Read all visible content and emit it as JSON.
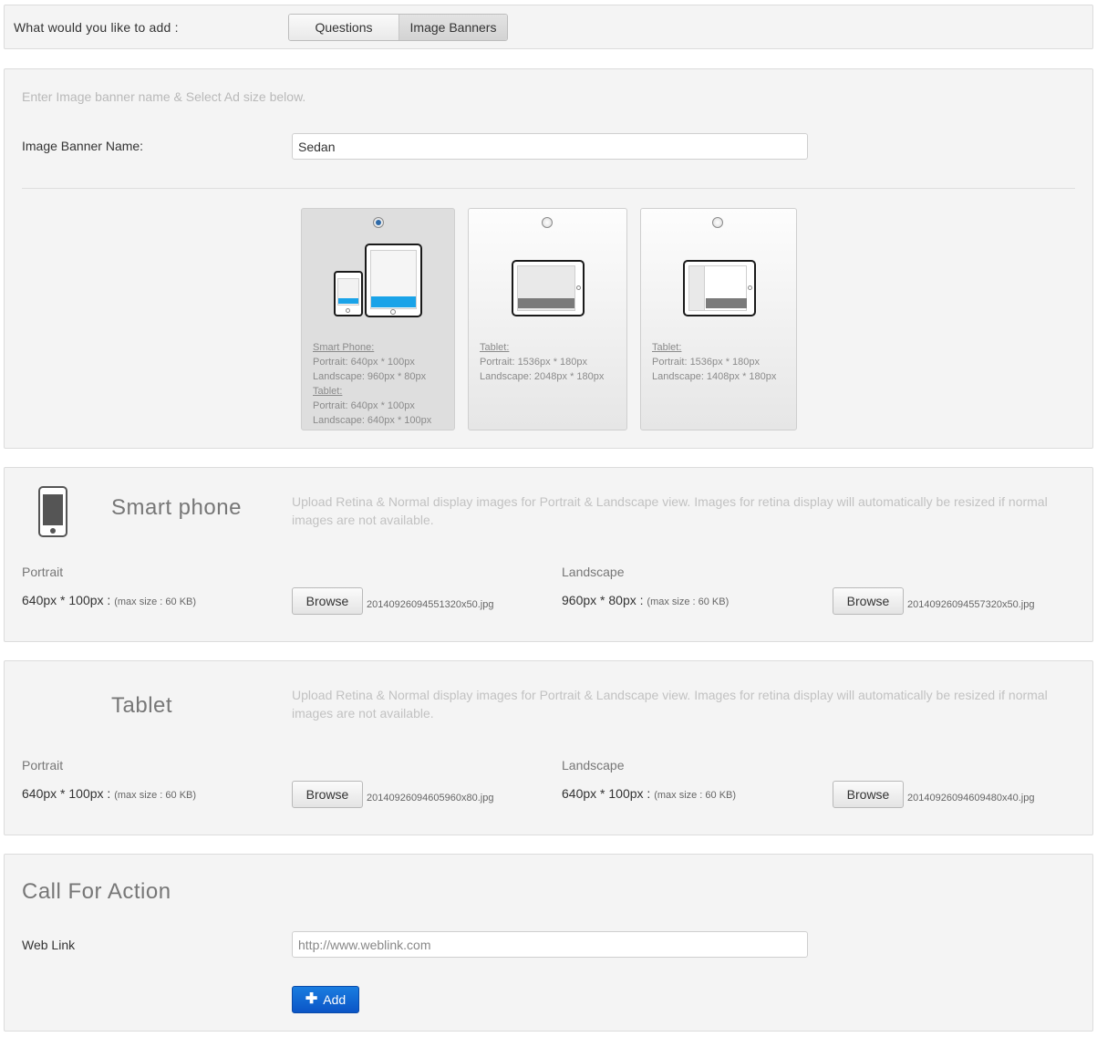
{
  "top": {
    "question": "What would you like to add :",
    "options": [
      {
        "label": "Questions",
        "selected": false
      },
      {
        "label": "Image Banners",
        "selected": true
      }
    ]
  },
  "banner": {
    "hint": "Enter Image banner name & Select Ad size below.",
    "name_label": "Image Banner Name:",
    "name_value": "Sedan",
    "sizes": [
      {
        "selected": true,
        "lines": [
          {
            "text": "Smart Phone:",
            "heading": true
          },
          {
            "text": "Portrait: 640px * 100px",
            "heading": false
          },
          {
            "text": "Landscape: 960px * 80px",
            "heading": false
          },
          {
            "text": "Tablet:",
            "heading": true
          },
          {
            "text": "Portrait: 640px * 100px",
            "heading": false
          },
          {
            "text": "Landscape: 640px * 100px",
            "heading": false
          }
        ]
      },
      {
        "selected": false,
        "lines": [
          {
            "text": "Tablet:",
            "heading": true
          },
          {
            "text": "Portrait: 1536px * 180px",
            "heading": false
          },
          {
            "text": "Landscape: 2048px * 180px",
            "heading": false
          }
        ]
      },
      {
        "selected": false,
        "lines": [
          {
            "text": "Tablet:",
            "heading": true
          },
          {
            "text": "Portrait: 1536px * 180px",
            "heading": false
          },
          {
            "text": "Landscape: 1408px * 180px",
            "heading": false
          }
        ]
      }
    ]
  },
  "smartphone": {
    "title": "Smart phone",
    "description": "Upload Retina & Normal display images for Portrait & Landscape view. Images for retina display will automatically be resized if normal images are not available.",
    "portrait": {
      "label": "Portrait",
      "dims": "640px * 100px :",
      "max": "(max size : 60 KB)",
      "browse": "Browse",
      "file": "20140926094551320x50.jpg"
    },
    "landscape": {
      "label": "Landscape",
      "dims": "960px * 80px :",
      "max": "(max size : 60 KB)",
      "browse": "Browse",
      "file": "20140926094557320x50.jpg"
    }
  },
  "tablet": {
    "title": "Tablet",
    "description": "Upload Retina & Normal display images for Portrait & Landscape view. Images for retina display will automatically be resized if normal images are not available.",
    "portrait": {
      "label": "Portrait",
      "dims": "640px * 100px :",
      "max": "(max size : 60 KB)",
      "browse": "Browse",
      "file": "20140926094605960x80.jpg"
    },
    "landscape": {
      "label": "Landscape",
      "dims": "640px * 100px :",
      "max": "(max size : 60 KB)",
      "browse": "Browse",
      "file": "20140926094609480x40.jpg"
    }
  },
  "cta": {
    "title": "Call For Action",
    "weblink_label": "Web Link",
    "weblink_placeholder": "http://www.weblink.com",
    "weblink_value": "",
    "add_label": "Add"
  },
  "colors": {
    "accent": "#0b55c6",
    "ad_bar": "#1aa3e8",
    "ad_bar_dark": "#7a7a7a"
  },
  "icons": {
    "phone": "smartphone-icon",
    "add": "plus-icon"
  }
}
